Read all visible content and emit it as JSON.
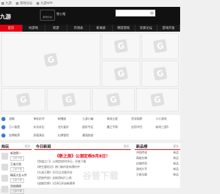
{
  "topbar": {
    "items": [
      "九游",
      "游戏论坛",
      "九游APP"
    ]
  },
  "header": {
    "logo_left": "九游",
    "logo_sub": "游戏论坛",
    "site_name": "赞小帮"
  },
  "nav": {
    "items": [
      "首页",
      "找游戏",
      "新游",
      "开测表",
      "新闻表",
      "网游游戏",
      "玩家论坛",
      "游戏开发"
    ]
  },
  "categories": {
    "rows": [
      [
        "战略",
        "单机好评",
        "新播放",
        "九游小编",
        "休闲五星",
        "资深观察",
        "小小游戏"
      ],
      [
        "万人备受",
        "实况对比",
        "也为爱好",
        "超好专区",
        "魔之手筒",
        "应用节目",
        "新闻三国5"
      ],
      [
        "金牌推荐",
        "即速演出",
        "幻想冒险",
        "最强独游",
        "",
        "",
        ""
      ]
    ]
  },
  "bottom": {
    "games": {
      "title": "热玩",
      "more": "更多",
      "items": [
        {
          "name": "新游第一",
          "btn": "立即下载"
        },
        {
          "name": "王者大陆",
          "btn": "立即下载"
        },
        {
          "name": "精英大乱斗传",
          "btn": "立即下载"
        },
        {
          "name": "剑侠情缘",
          "btn": "立即下载"
        }
      ]
    },
    "news": {
      "title": "今日新闻",
      "more": "更多",
      "headline": "《新之旅》公测定档9月8日！",
      "items": [
        "《剑道之门》公测定档9月6日，开放下载",
        "《转生冒险记》热门新作发布预约中",
        "《大战王朝》12月正式版开启",
        "《武侠传说》全新资料片上线",
        "《战舰世界》1月8日开启新赛季"
      ]
    },
    "rank": {
      "title": "新品榜",
      "more": "更多",
      "items": [
        {
          "name": "冲塔传说",
          "val": "新品"
        },
        {
          "name": "高能先锋",
          "val": "新品"
        },
        {
          "name": "幻城传奇",
          "val": "新品"
        },
        {
          "name": "游戏大亨",
          "val": "新品"
        },
        {
          "name": "王者无敌",
          "val": "新品"
        }
      ]
    }
  },
  "watermark": "谷普下载"
}
